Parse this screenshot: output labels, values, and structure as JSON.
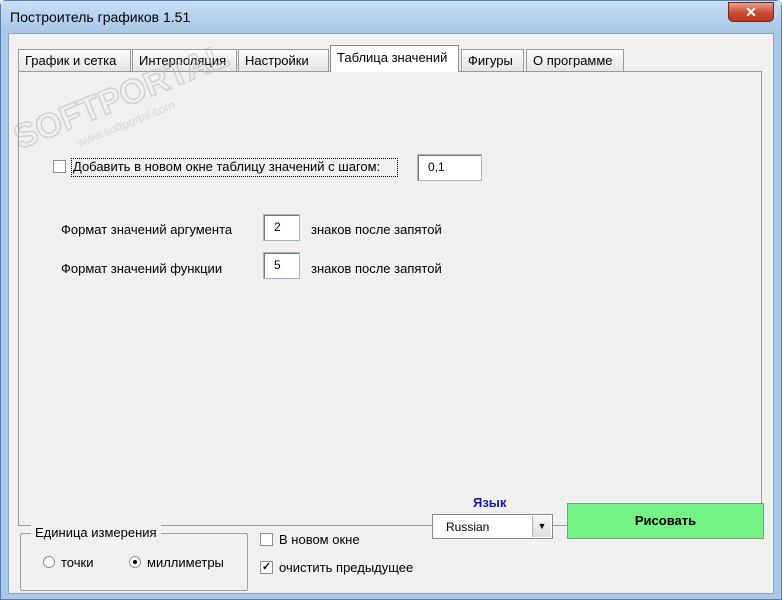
{
  "window": {
    "title": "Построитель графиков 1.51",
    "close_glyph": "✕"
  },
  "tabs": [
    {
      "label": "График и сетка"
    },
    {
      "label": "Интерполяция"
    },
    {
      "label": "Настройки"
    },
    {
      "label": "Таблица значений",
      "active": true
    },
    {
      "label": "Фигуры"
    },
    {
      "label": "О программе"
    }
  ],
  "table_tab": {
    "add_table_checkbox": {
      "label": "Добавить в новом окне таблицу значений с шагом:",
      "checked": false
    },
    "step_value": "0,1",
    "argument_format": {
      "label": "Формат значений аргумента",
      "value": "2",
      "suffix": "знаков после запятой"
    },
    "function_format": {
      "label": "Формат значений функции",
      "value": "5",
      "suffix": "знаков после запятой"
    }
  },
  "units": {
    "title": "Единица измерения",
    "options": [
      {
        "label": "точки",
        "checked": false
      },
      {
        "label": "миллиметры",
        "checked": true
      }
    ]
  },
  "options": {
    "new_window": {
      "label": "В новом окне",
      "checked": false
    },
    "clear_previous": {
      "label": "очистить предыдущее",
      "checked": true
    }
  },
  "language": {
    "title": "Язык",
    "selected": "Russian"
  },
  "draw_button": {
    "label": "Рисовать"
  },
  "watermark": {
    "text": "SOFTPORTAL",
    "url": "www.softportal.com"
  },
  "icons": {
    "check": "✓",
    "dropdown": "▼"
  },
  "colors": {
    "draw_button": "#74f285",
    "language_title": "#1a1aa6",
    "titlebar": "#a7c6e6",
    "close_button": "#c94a32"
  }
}
